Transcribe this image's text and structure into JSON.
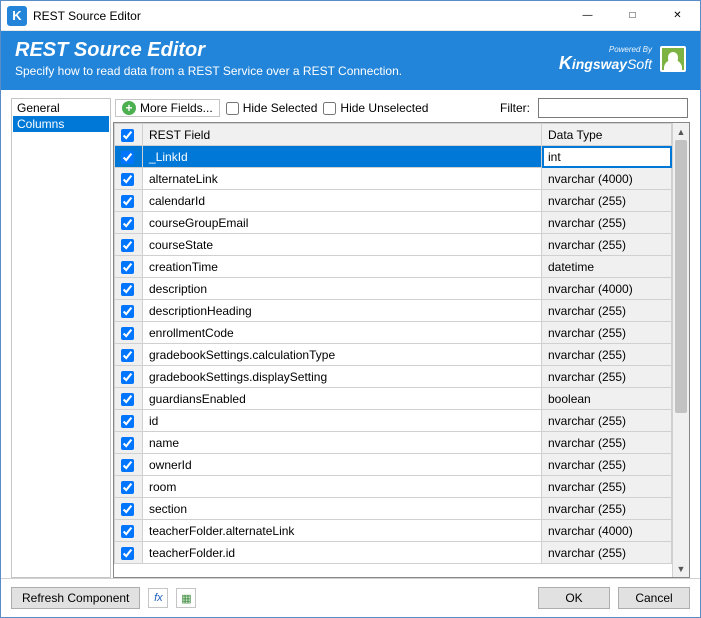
{
  "window": {
    "title": "REST Source Editor"
  },
  "header": {
    "title": "REST Source Editor",
    "subtitle": "Specify how to read data from a REST Service over a REST Connection.",
    "brand_small": "Powered By",
    "brand_name": "KingswaySoft"
  },
  "sidebar": {
    "items": [
      {
        "label": "General",
        "selected": false
      },
      {
        "label": "Columns",
        "selected": true
      }
    ]
  },
  "toolbar": {
    "more_fields": "More Fields...",
    "hide_selected": "Hide Selected",
    "hide_unselected": "Hide Unselected",
    "filter_label": "Filter:",
    "filter_value": ""
  },
  "grid": {
    "headers": {
      "field": "REST Field",
      "type": "Data Type"
    },
    "rows": [
      {
        "checked": true,
        "field": "_LinkId",
        "type": "int",
        "selected": true
      },
      {
        "checked": true,
        "field": "alternateLink",
        "type": "nvarchar (4000)"
      },
      {
        "checked": true,
        "field": "calendarId",
        "type": "nvarchar (255)"
      },
      {
        "checked": true,
        "field": "courseGroupEmail",
        "type": "nvarchar (255)"
      },
      {
        "checked": true,
        "field": "courseState",
        "type": "nvarchar (255)"
      },
      {
        "checked": true,
        "field": "creationTime",
        "type": "datetime"
      },
      {
        "checked": true,
        "field": "description",
        "type": "nvarchar (4000)"
      },
      {
        "checked": true,
        "field": "descriptionHeading",
        "type": "nvarchar (255)"
      },
      {
        "checked": true,
        "field": "enrollmentCode",
        "type": "nvarchar (255)"
      },
      {
        "checked": true,
        "field": "gradebookSettings.calculationType",
        "type": "nvarchar (255)"
      },
      {
        "checked": true,
        "field": "gradebookSettings.displaySetting",
        "type": "nvarchar (255)"
      },
      {
        "checked": true,
        "field": "guardiansEnabled",
        "type": "boolean"
      },
      {
        "checked": true,
        "field": "id",
        "type": "nvarchar (255)"
      },
      {
        "checked": true,
        "field": "name",
        "type": "nvarchar (255)"
      },
      {
        "checked": true,
        "field": "ownerId",
        "type": "nvarchar (255)"
      },
      {
        "checked": true,
        "field": "room",
        "type": "nvarchar (255)"
      },
      {
        "checked": true,
        "field": "section",
        "type": "nvarchar (255)"
      },
      {
        "checked": true,
        "field": "teacherFolder.alternateLink",
        "type": "nvarchar (4000)"
      },
      {
        "checked": true,
        "field": "teacherFolder.id",
        "type": "nvarchar (255)"
      }
    ]
  },
  "footer": {
    "refresh": "Refresh Component",
    "ok": "OK",
    "cancel": "Cancel"
  }
}
